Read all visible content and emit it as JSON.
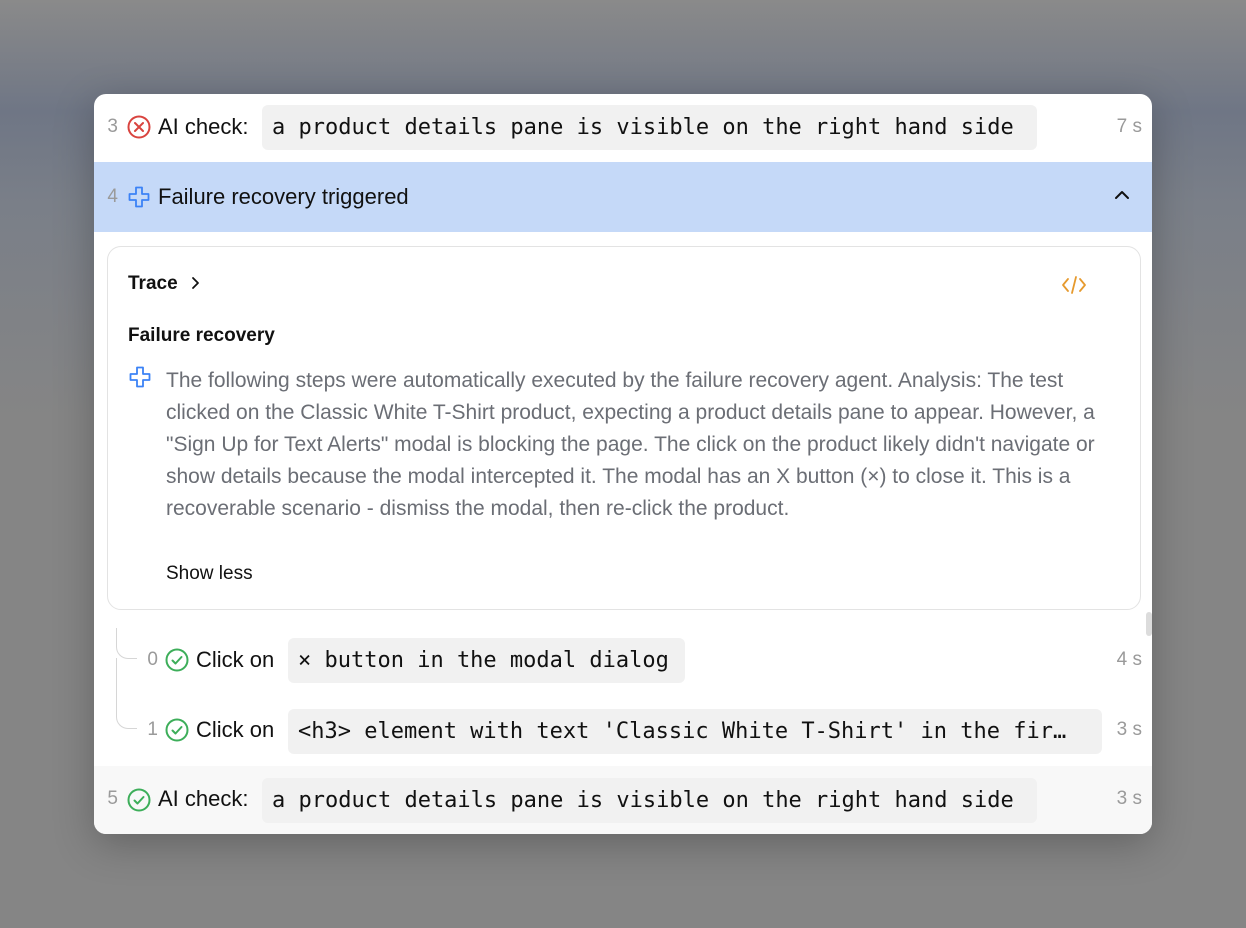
{
  "steps": {
    "s3": {
      "num": "3",
      "label": "AI check:",
      "code": "a product details pane is visible on the right hand side",
      "duration": "7 s",
      "status": "failed"
    },
    "s4": {
      "num": "4",
      "label": "Failure recovery triggered",
      "expanded": true
    },
    "s5": {
      "num": "5",
      "label": "AI check:",
      "code": "a product details pane is visible on the right hand side",
      "duration": "3 s",
      "status": "passed"
    }
  },
  "card": {
    "trace_label": "Trace",
    "section_title": "Failure recovery",
    "description": "The following steps were automatically executed by the failure recovery agent. Analysis: The test clicked on the Classic White T-Shirt product, expecting a product details pane to appear. However, a \"Sign Up for Text Alerts\" modal is blocking the page. The click on the product likely didn't navigate or show details because the modal intercepted it. The modal has an X button (×) to close it. This is a recoverable scenario - dismiss the modal, then re-click the product.",
    "show_less": "Show less"
  },
  "substeps": [
    {
      "num": "0",
      "label": "Click on",
      "code": "× button in the modal dialog",
      "duration": "4 s",
      "status": "passed"
    },
    {
      "num": "1",
      "label": "Click on",
      "code": "<h3> element with text 'Classic White T-Shirt' in the fir…",
      "duration": "3 s",
      "status": "passed"
    }
  ],
  "colors": {
    "fail": "#d9443f",
    "pass": "#3dae5a",
    "accent": "#3b82f6",
    "highlight": "#c5d9f8",
    "code_icon": "#e69a2e"
  }
}
